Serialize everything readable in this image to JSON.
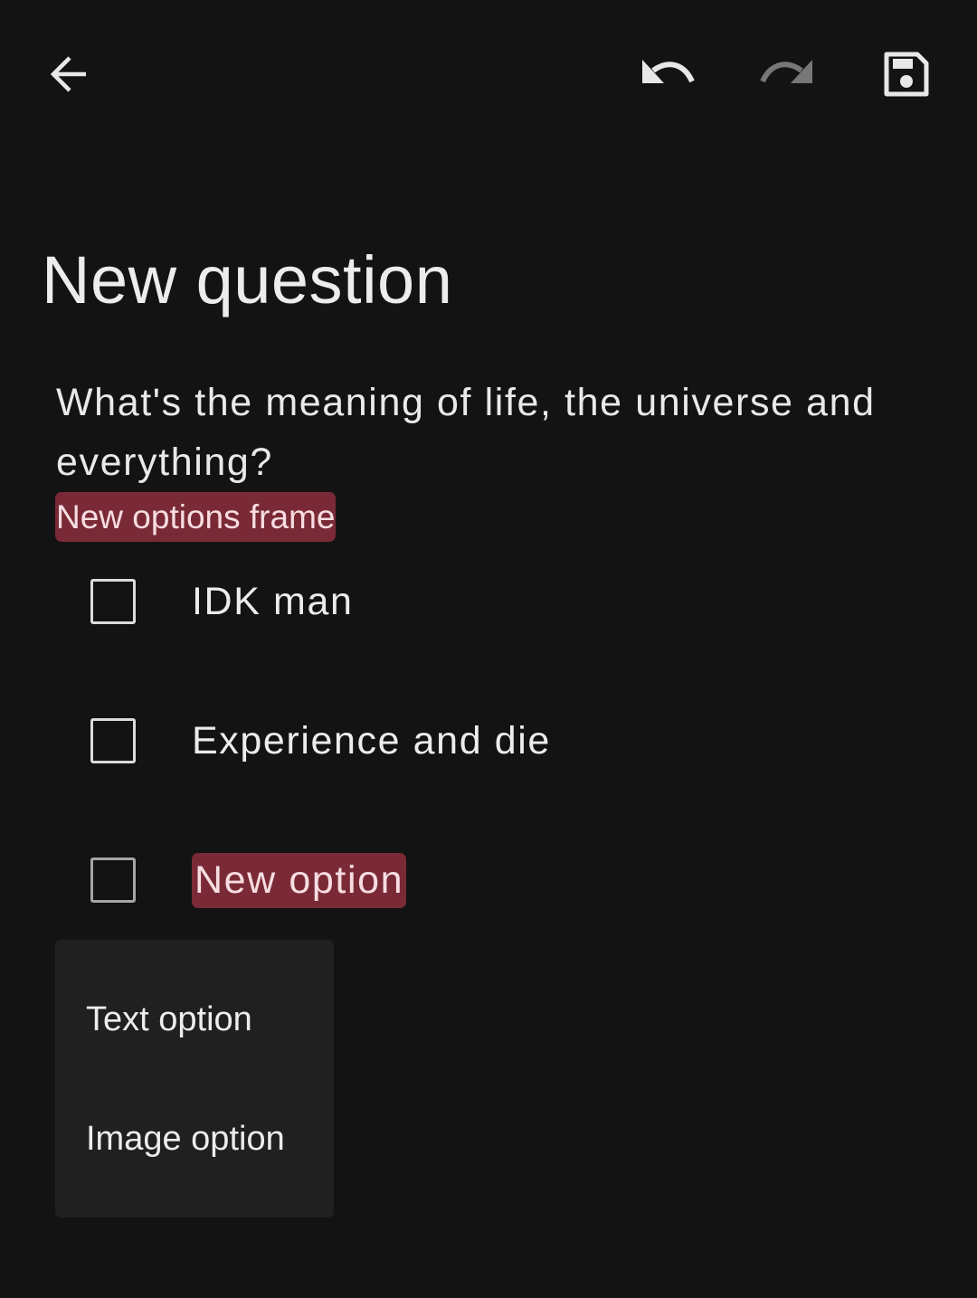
{
  "toolbar": {
    "back_icon": "arrow-left-icon",
    "undo_icon": "undo-icon",
    "redo_icon": "redo-icon",
    "save_icon": "save-floppy-icon",
    "redo_enabled": false
  },
  "page": {
    "title": "New question",
    "question_text": "What's the meaning of life, the universe and everything?",
    "frame_tag": "New options frame"
  },
  "options": [
    {
      "label": "IDK man",
      "checked": false
    },
    {
      "label": "Experience and die",
      "checked": false
    },
    {
      "label": "New option",
      "checked": false
    }
  ],
  "menu": {
    "items": [
      {
        "label": "Text option"
      },
      {
        "label": "Image option"
      }
    ]
  },
  "colors": {
    "background": "#131313",
    "highlight": "#7a2a36",
    "highlight_text": "#f6dde1",
    "menu_background": "#202020",
    "disabled_icon": "#777777"
  }
}
